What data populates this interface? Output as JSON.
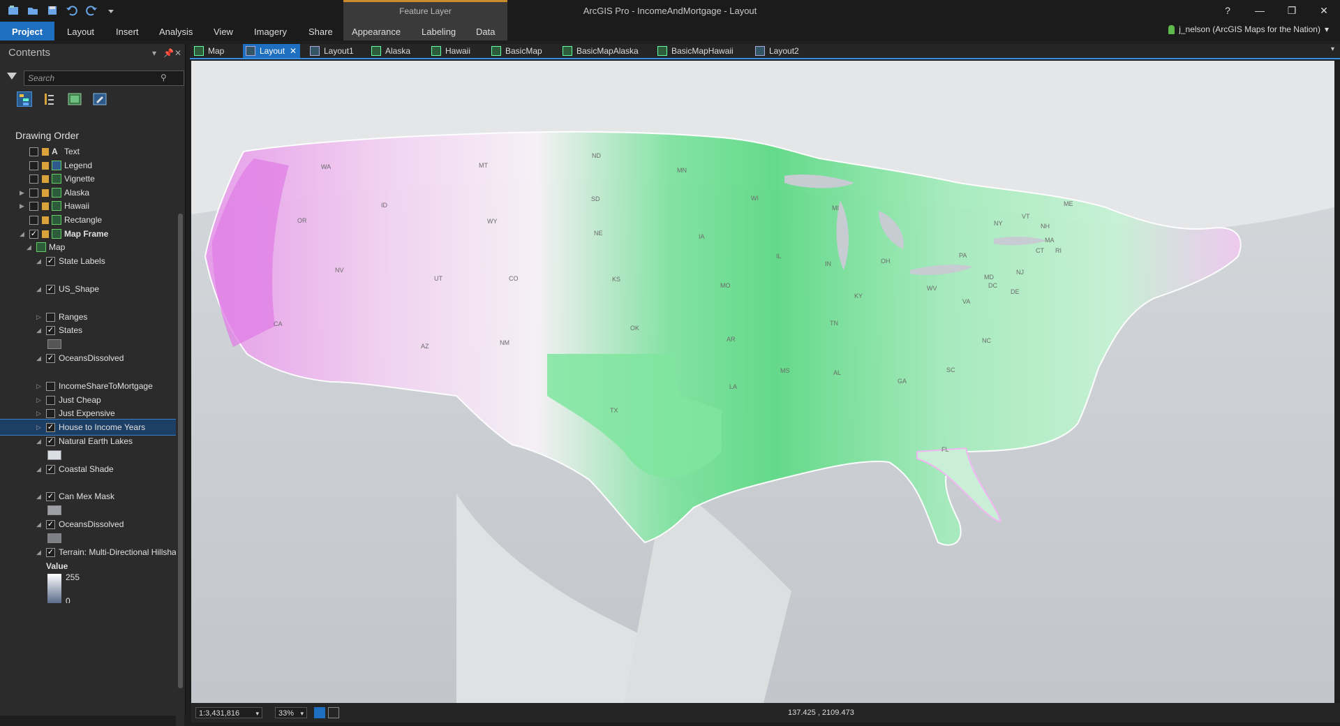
{
  "window": {
    "title": "ArcGIS Pro - IncomeAndMortgage - Layout",
    "contextual_header": "Feature Layer",
    "controls": [
      "?",
      "—",
      "❐",
      "✕"
    ]
  },
  "ribbon": {
    "tabs": [
      "Project",
      "Layout",
      "Insert",
      "Analysis",
      "View",
      "Imagery",
      "Share",
      "Appearance",
      "Labeling",
      "Data"
    ],
    "user": "j_nelson (ArcGIS Maps for the Nation)"
  },
  "contents": {
    "title": "Contents",
    "search_placeholder": "Search",
    "section": "Drawing Order",
    "layers": [
      {
        "label": "Text"
      },
      {
        "label": "Legend"
      },
      {
        "label": "Vignette"
      },
      {
        "label": "Alaska"
      },
      {
        "label": "Hawaii"
      },
      {
        "label": "Rectangle"
      },
      {
        "label": "Map Frame"
      },
      {
        "label": "Map"
      },
      {
        "label": "State Labels"
      },
      {
        "label": "US_Shape"
      },
      {
        "label": "Ranges"
      },
      {
        "label": "States"
      },
      {
        "label": "OceansDissolved"
      },
      {
        "label": "IncomeShareToMortgage"
      },
      {
        "label": "Just Cheap"
      },
      {
        "label": "Just Expensive"
      },
      {
        "label": "House to Income Years"
      },
      {
        "label": "Natural Earth Lakes"
      },
      {
        "label": "Coastal Shade"
      },
      {
        "label": "Can Mex Mask"
      },
      {
        "label": "OceansDissolved"
      },
      {
        "label": "Terrain: Multi-Directional Hillsha"
      }
    ],
    "value_legend": {
      "title": "Value",
      "high": "255",
      "low": "0"
    }
  },
  "doc_tabs": [
    "Map",
    "Layout",
    "Layout1",
    "Alaska",
    "Hawaii",
    "BasicMap",
    "BasicMapAlaska",
    "BasicMapHawaii",
    "Layout2"
  ],
  "map": {
    "state_labels": [
      "WA",
      "OR",
      "CA",
      "NV",
      "ID",
      "MT",
      "WY",
      "UT",
      "AZ",
      "CO",
      "NM",
      "ND",
      "SD",
      "NE",
      "KS",
      "OK",
      "TX",
      "MN",
      "IA",
      "MO",
      "AR",
      "LA",
      "WI",
      "IL",
      "MS",
      "AL",
      "TN",
      "KY",
      "IN",
      "MI",
      "OH",
      "WV",
      "VA",
      "NC",
      "SC",
      "GA",
      "FL",
      "PA",
      "NY",
      "VT",
      "NH",
      "ME",
      "MA",
      "CT",
      "RI",
      "NJ",
      "DE",
      "MD",
      "DC"
    ]
  },
  "status": {
    "scale": "1:3,431,816",
    "zoom": "33%",
    "coordinates": "137.425 , 2109.473"
  }
}
